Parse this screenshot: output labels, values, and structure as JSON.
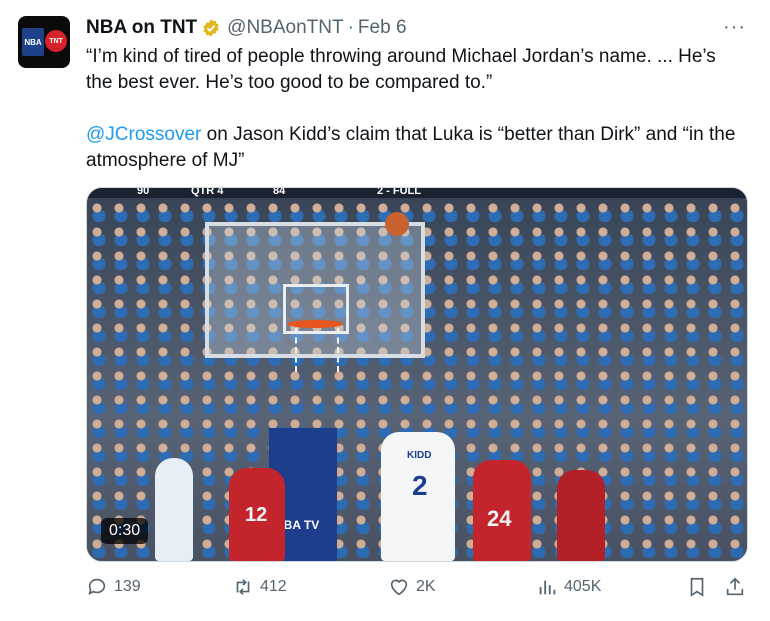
{
  "tweet": {
    "author_name": "NBA on TNT",
    "handle": "@NBAonTNT",
    "separator": "·",
    "date": "Feb 6",
    "more": "···",
    "quote": "“I’m kind of tired of people throwing around Michael Jordan’s name. ... He’s the best ever. He’s too good to be compared to.”",
    "mention": "@JCrossover",
    "context": " on Jason Kidd’s claim that Luka is “better than Dirk” and “in the atmosphere of MJ”"
  },
  "avatar": {
    "nba": "NBA",
    "tnt": "TNT"
  },
  "video": {
    "duration": "0:30",
    "score_left": "90",
    "quarter": "QTR 4",
    "score_right": "84",
    "shot_clock": "2 - FULL",
    "kidd_name": "KIDD",
    "kidd_number": "2",
    "red_number_1": "12",
    "red_number_2": "24",
    "stanchion_text": "NBA TV"
  },
  "metrics": {
    "replies": "139",
    "reposts": "412",
    "likes": "2K",
    "views": "405K"
  },
  "colors": {
    "accent": "#1d9bf0",
    "muted": "#536471",
    "verified": "#e2b719"
  },
  "icons": [
    "comment-icon",
    "retweet-icon",
    "heart-icon",
    "views-icon",
    "bookmark-icon",
    "share-icon",
    "verified-icon",
    "more-icon"
  ]
}
